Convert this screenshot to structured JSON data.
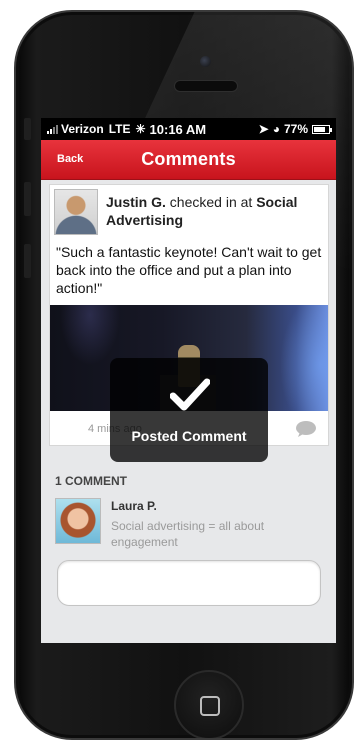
{
  "status_bar": {
    "carrier": "Verizon",
    "network": "LTE",
    "time": "10:16 AM",
    "battery": "77%",
    "battery_level": 0.77
  },
  "nav": {
    "back_label": "Back",
    "title": "Comments"
  },
  "post": {
    "author": "Justin G.",
    "action_text": " checked in at ",
    "place": "Social Advertising",
    "text": "\"Such a fantastic keynote! Can't wait to get back into the office and put a plan into action!\"",
    "time_ago": "4 mins ago"
  },
  "toast": {
    "message": "Posted Comment"
  },
  "comments": {
    "header": "1 COMMENT",
    "items": [
      {
        "author": "Laura P.",
        "text": "Social advertising = all about engagement"
      }
    ]
  },
  "comment_input": {
    "value": "",
    "placeholder": ""
  },
  "colors": {
    "accent": "#d8222a",
    "screen_bg": "#e7e8ea"
  }
}
